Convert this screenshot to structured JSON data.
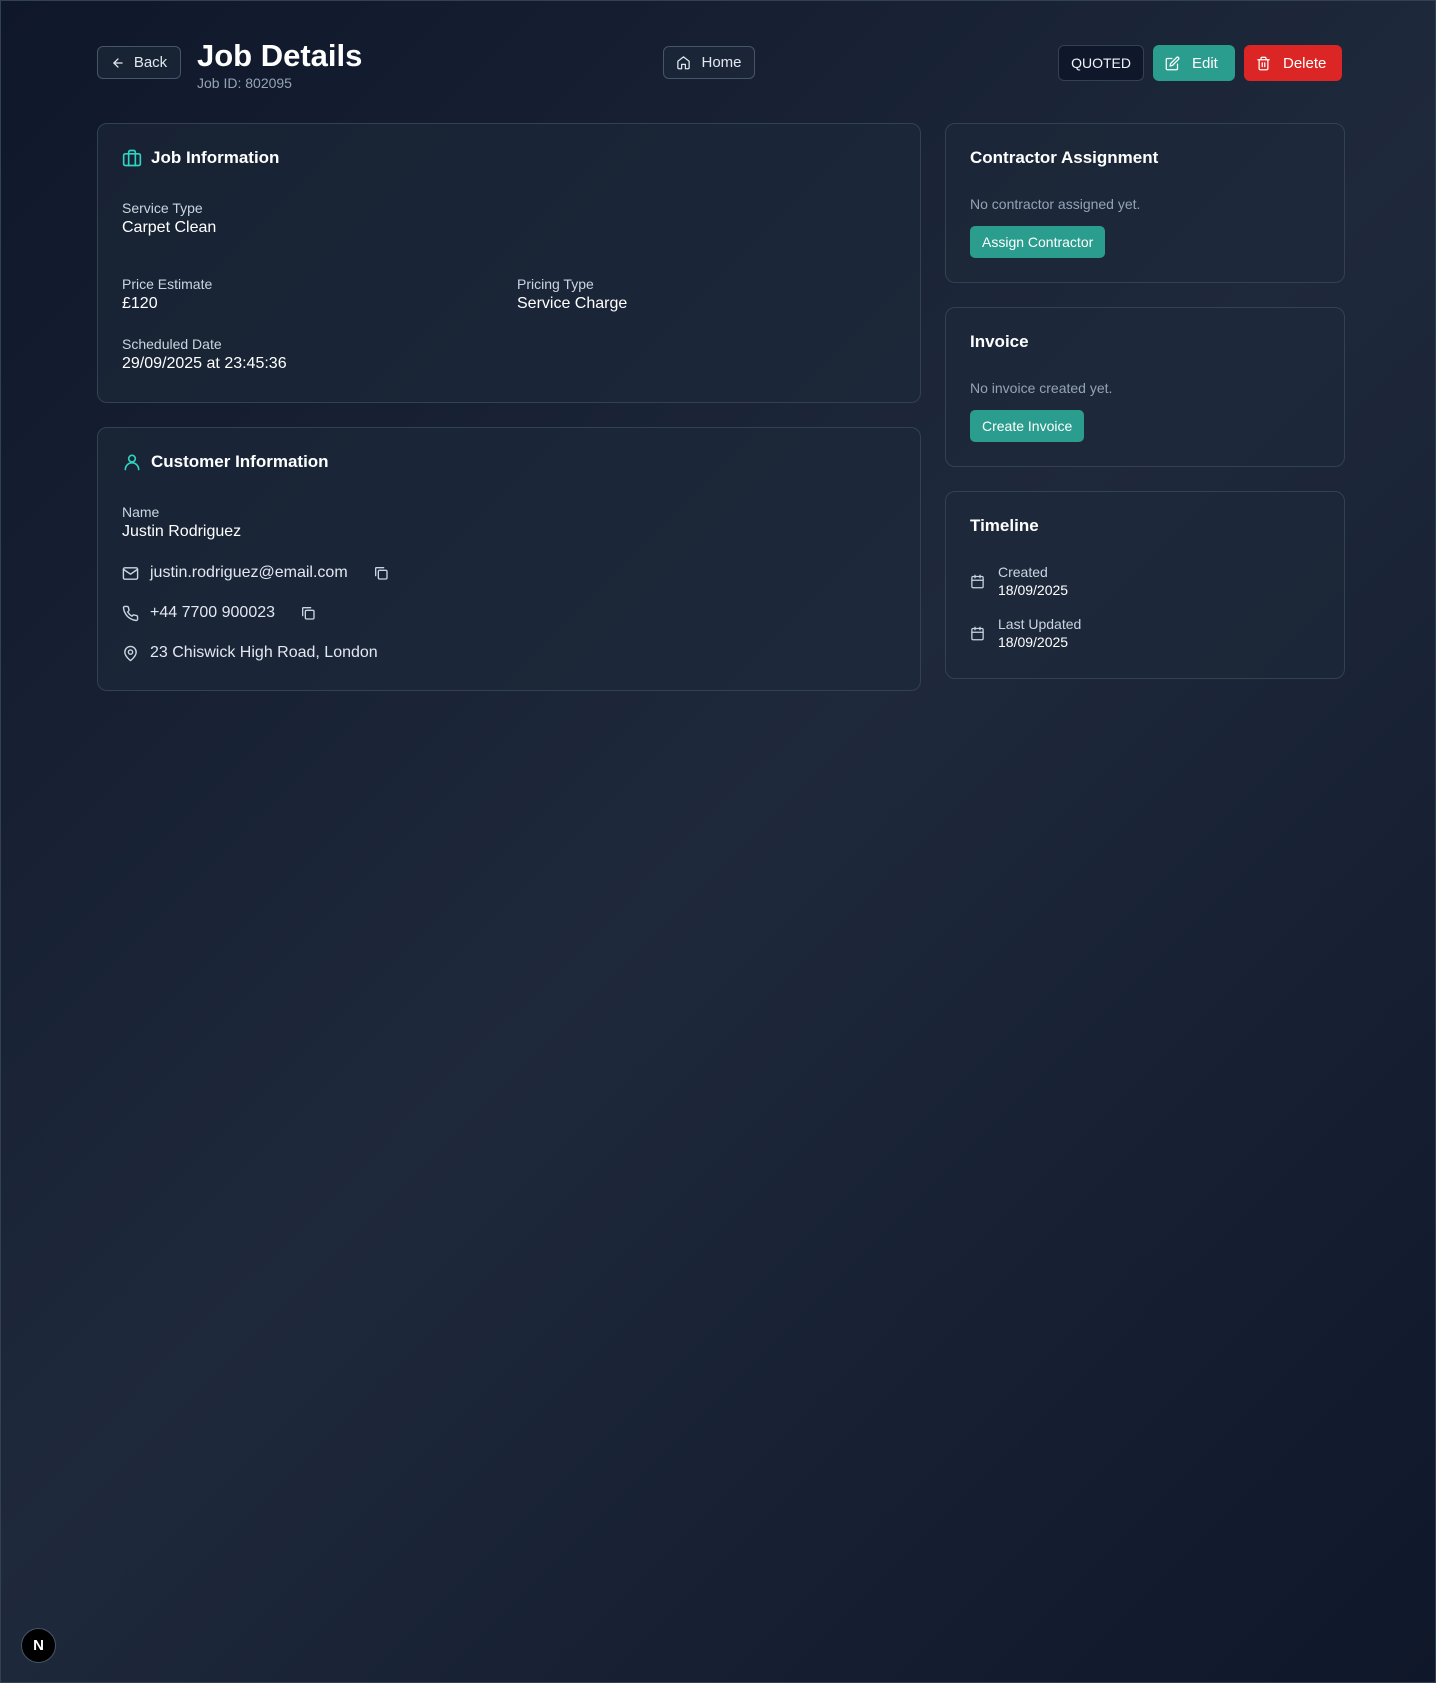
{
  "header": {
    "back_label": "Back",
    "title": "Job Details",
    "job_id": "Job ID: 802095",
    "home_label": "Home",
    "status": "QUOTED",
    "edit_label": "Edit",
    "delete_label": "Delete"
  },
  "job_info": {
    "title": "Job Information",
    "service_type_label": "Service Type",
    "service_type": "Carpet Clean",
    "price_label": "Price Estimate",
    "price": "£120",
    "pricing_type_label": "Pricing Type",
    "pricing_type": "Service Charge",
    "scheduled_label": "Scheduled Date",
    "scheduled": "29/09/2025 at 23:45:36"
  },
  "customer": {
    "title": "Customer Information",
    "name_label": "Name",
    "name": "Justin Rodriguez",
    "email": "justin.rodriguez@email.com",
    "phone": "+44 7700 900023",
    "address": "23 Chiswick High Road, London"
  },
  "contractor": {
    "title": "Contractor Assignment",
    "empty_text": "No contractor assigned yet.",
    "button": "Assign Contractor"
  },
  "invoice": {
    "title": "Invoice",
    "empty_text": "No invoice created yet.",
    "button": "Create Invoice"
  },
  "timeline": {
    "title": "Timeline",
    "created_label": "Created",
    "created": "18/09/2025",
    "updated_label": "Last Updated",
    "updated": "18/09/2025"
  },
  "dev_badge": "N",
  "colors": {
    "accent": "#2a9d8f",
    "danger": "#dc2626",
    "background": "#0f172a"
  },
  "icons": [
    "arrow-left-icon",
    "home-icon",
    "edit-icon",
    "trash-icon",
    "briefcase-icon",
    "user-icon",
    "mail-icon",
    "copy-icon",
    "phone-icon",
    "map-pin-icon",
    "calendar-icon"
  ]
}
